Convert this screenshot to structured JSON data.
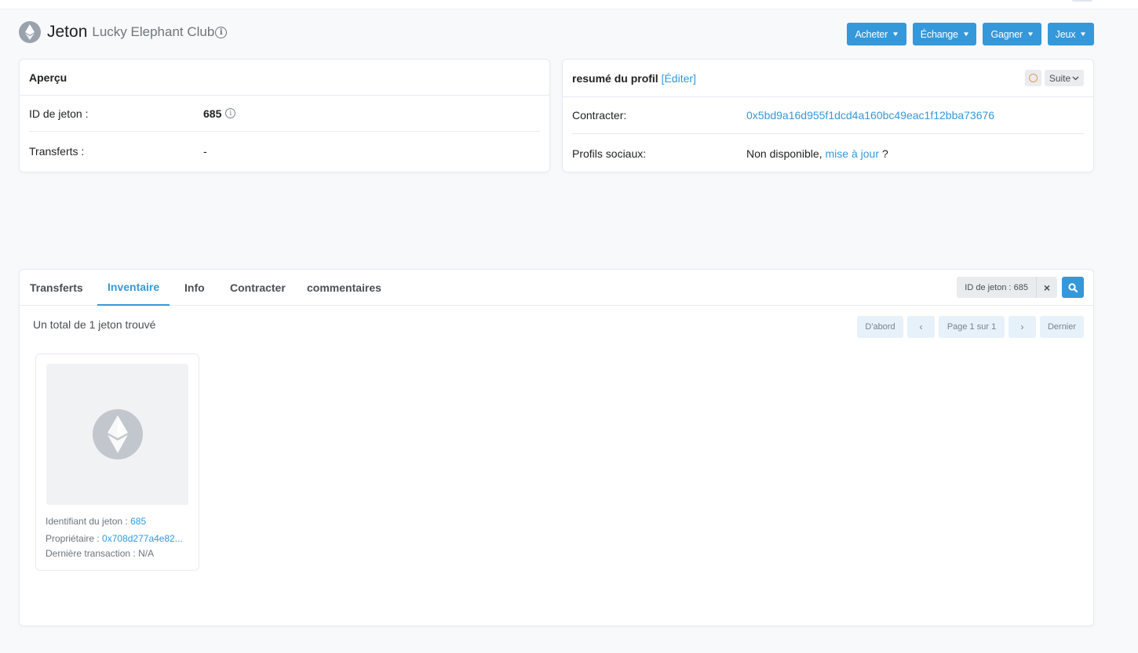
{
  "header": {
    "title": "Jeton",
    "subtitle": "Lucky Elephant Club",
    "buttons": [
      {
        "label": "Acheter"
      },
      {
        "label": "Échange"
      },
      {
        "label": "Gagner"
      },
      {
        "label": "Jeux"
      }
    ]
  },
  "overview": {
    "title": "Aperçu",
    "token_id_label": "ID de jeton :",
    "token_id_value": "685",
    "transfers_label": "Transferts :",
    "transfers_value": "-"
  },
  "profile": {
    "title": "resumé du profil",
    "edit_link": "[Éditer]",
    "more_label": "Suite",
    "contract_label": "Contracter:",
    "contract_value": "0x5bd9a16d955f1dcd4a160bc49eac1f12bba73676",
    "social_label": "Profils sociaux:",
    "social_value": "Non disponible,",
    "social_update_link": "mise à jour",
    "social_question": "?"
  },
  "tabs": [
    {
      "label": "Transferts",
      "active": false
    },
    {
      "label": "Inventaire",
      "active": true
    },
    {
      "label": "Info",
      "active": false
    },
    {
      "label": "Contracter",
      "active": false
    },
    {
      "label": "commentaires",
      "active": false
    }
  ],
  "filter": {
    "chip_text": "ID de jeton : 685",
    "clear_symbol": "×"
  },
  "inventory": {
    "total_text": "Un total de 1 jeton trouvé",
    "pager": {
      "first": "D'abord",
      "prev": "‹",
      "page_text": "Page 1 sur 1",
      "next": "›",
      "last": "Dernier"
    },
    "items": [
      {
        "token_id_label": "Identifiant du jeton :",
        "token_id_value": "685",
        "owner_label": "Propriétaire :",
        "owner_value": "0x708d277a4e82...",
        "last_tx_label": "Dernière transaction :",
        "last_tx_value": "N/A"
      }
    ]
  },
  "colors": {
    "accent": "#3498db",
    "text": "#1e2022",
    "muted": "#6c757e",
    "border": "#e7eaf3"
  }
}
